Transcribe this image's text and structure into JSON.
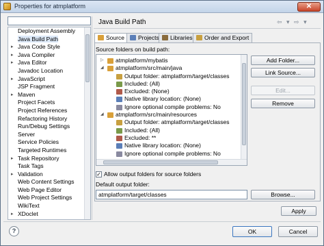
{
  "window": {
    "title": "Properties for atmplatform",
    "close_label": "✕"
  },
  "filter": {
    "value": ""
  },
  "left_tree": {
    "items": [
      {
        "label": "Deployment Assembly",
        "expander": ""
      },
      {
        "label": "Java Build Path",
        "expander": "",
        "selected": true
      },
      {
        "label": "Java Code Style",
        "expander": "▸"
      },
      {
        "label": "Java Compiler",
        "expander": "▸"
      },
      {
        "label": "Java Editor",
        "expander": "▸"
      },
      {
        "label": "Javadoc Location",
        "expander": ""
      },
      {
        "label": "JavaScript",
        "expander": "▸"
      },
      {
        "label": "JSP Fragment",
        "expander": ""
      },
      {
        "label": "Maven",
        "expander": "▸"
      },
      {
        "label": "Project Facets",
        "expander": ""
      },
      {
        "label": "Project References",
        "expander": ""
      },
      {
        "label": "Refactoring History",
        "expander": ""
      },
      {
        "label": "Run/Debug Settings",
        "expander": ""
      },
      {
        "label": "Server",
        "expander": ""
      },
      {
        "label": "Service Policies",
        "expander": ""
      },
      {
        "label": "Targeted Runtimes",
        "expander": ""
      },
      {
        "label": "Task Repository",
        "expander": "▸"
      },
      {
        "label": "Task Tags",
        "expander": ""
      },
      {
        "label": "Validation",
        "expander": "▸"
      },
      {
        "label": "Web Content Settings",
        "expander": ""
      },
      {
        "label": "Web Page Editor",
        "expander": ""
      },
      {
        "label": "Web Project Settings",
        "expander": ""
      },
      {
        "label": "WikiText",
        "expander": ""
      },
      {
        "label": "XDoclet",
        "expander": "▸"
      }
    ]
  },
  "page": {
    "title": "Java Build Path",
    "nav": "⇦ ▾ ⇨ ▾"
  },
  "tabs": [
    {
      "label": "Source",
      "active": true,
      "color": "#d9a03a"
    },
    {
      "label": "Projects",
      "active": false,
      "color": "#5b7fb8"
    },
    {
      "label": "Libraries",
      "active": false,
      "color": "#8a6b3c"
    },
    {
      "label": "Order and Export",
      "active": false,
      "color": "#c8a040"
    }
  ],
  "source": {
    "label": "Source folders on build path:",
    "rows": [
      {
        "text": "atmplatform/mybatis",
        "level": 0,
        "expander": "▷",
        "icon": "folder"
      },
      {
        "text": "atmplatform/src/main/java",
        "level": 0,
        "expander": "◢",
        "icon": "folder"
      },
      {
        "text": "Output folder: atmplatform/target/classes",
        "level": 1,
        "expander": "",
        "icon": "output"
      },
      {
        "text": "Included: (All)",
        "level": 1,
        "expander": "",
        "icon": "included"
      },
      {
        "text": "Excluded: (None)",
        "level": 1,
        "expander": "",
        "icon": "excluded"
      },
      {
        "text": "Native library location: (None)",
        "level": 1,
        "expander": "",
        "icon": "native"
      },
      {
        "text": "Ignore optional compile problems: No",
        "level": 1,
        "expander": "",
        "icon": "ignore"
      },
      {
        "text": "atmplatform/src/main/resources",
        "level": 0,
        "expander": "◢",
        "icon": "folder"
      },
      {
        "text": "Output folder: atmplatform/target/classes",
        "level": 1,
        "expander": "",
        "icon": "output"
      },
      {
        "text": "Included: (All)",
        "level": 1,
        "expander": "",
        "icon": "included"
      },
      {
        "text": "Excluded: **",
        "level": 1,
        "expander": "",
        "icon": "excluded"
      },
      {
        "text": "Native library location: (None)",
        "level": 1,
        "expander": "",
        "icon": "native"
      },
      {
        "text": "Ignore optional compile problems: No",
        "level": 1,
        "expander": "",
        "icon": "ignore"
      },
      {
        "text": "atmplatform/src/test/java",
        "level": 0,
        "expander": "▷",
        "icon": "folder"
      }
    ],
    "add_folder": "Add Folder...",
    "link_source": "Link Source...",
    "edit": "Edit...",
    "remove": "Remove",
    "allow_output_label": "Allow output folders for source folders",
    "allow_output_checked": "✓",
    "default_output_label": "Default output folder:",
    "default_output_value": "atmplatform/target/classes",
    "browse": "Browse..."
  },
  "footer": {
    "apply": "Apply",
    "ok": "OK",
    "cancel": "Cancel",
    "help": "?"
  }
}
